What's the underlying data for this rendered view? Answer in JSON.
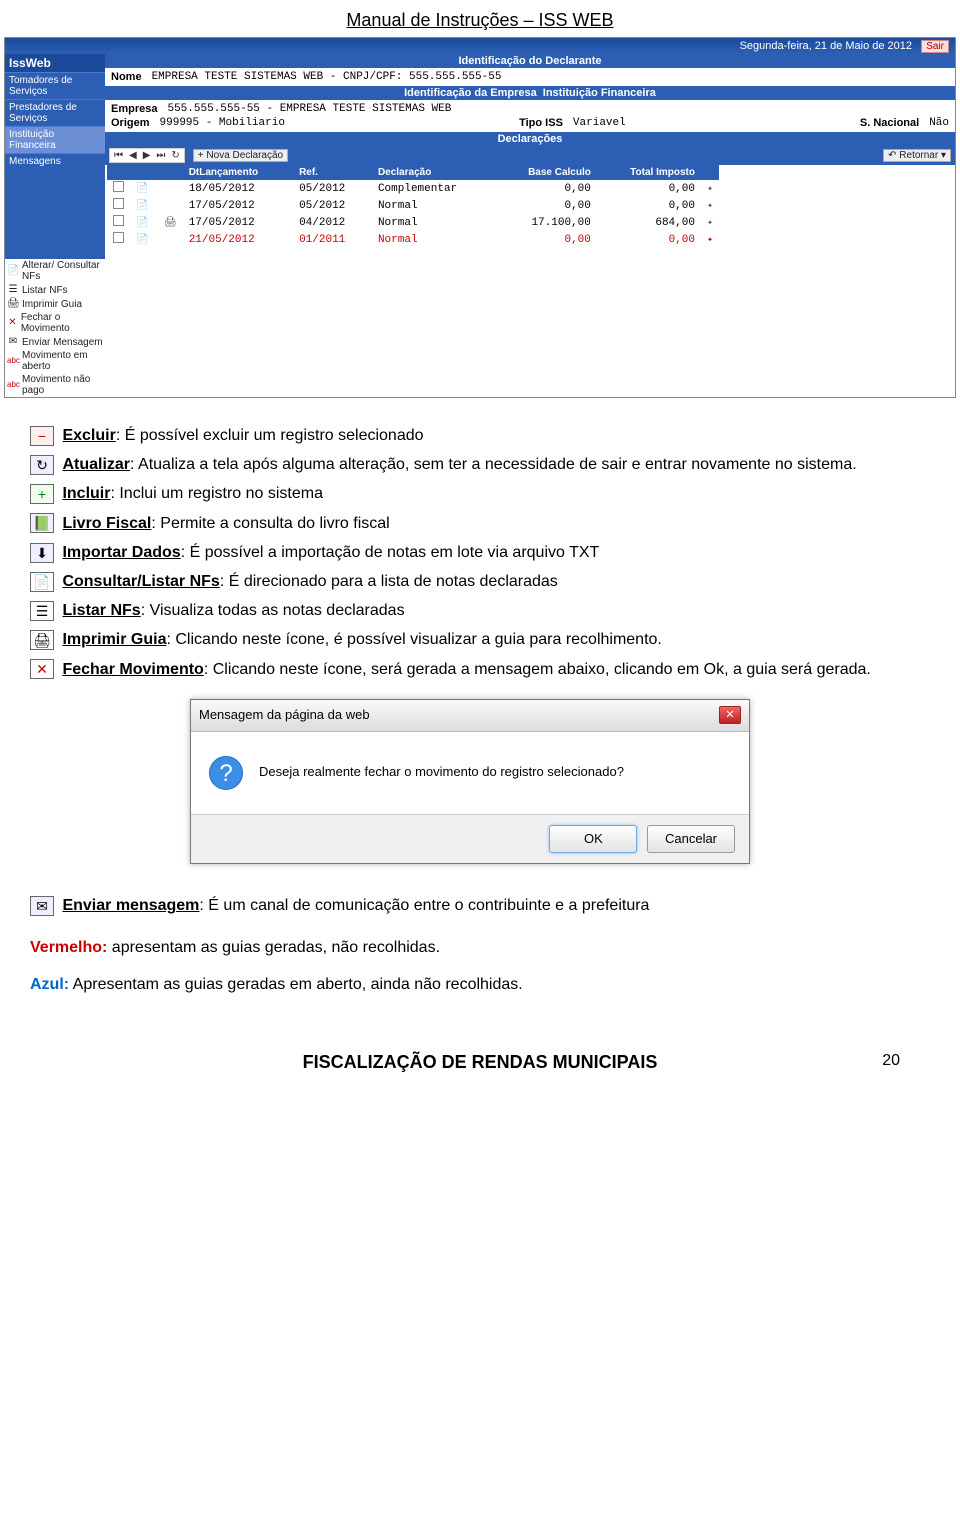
{
  "doc": {
    "header_title": "Manual de Instruções – ISS WEB",
    "footer_text": "FISCALIZAÇÃO DE RENDAS MUNICIPAIS",
    "page_number": "20"
  },
  "topbar": {
    "date": "Segunda-feira, 21 de Maio de 2012",
    "exit": "Sair"
  },
  "sidebar": {
    "brand": "IssWeb",
    "items": [
      "Tomadores de Serviços",
      "Prestadores de Serviços",
      "Instituição Financeira",
      "Mensagens"
    ]
  },
  "sidebar_bottom": {
    "items": [
      "Alterar/ Consultar NFs",
      "Listar NFs",
      "Imprimir Guia",
      "Fechar o Movimento",
      "Enviar Mensagem",
      "Movimento em aberto",
      "Movimento não pago"
    ]
  },
  "ident_declarante": {
    "title": "Identificação do Declarante",
    "nome_lbl": "Nome",
    "nome_val": "EMPRESA TESTE SISTEMAS WEB - CNPJ/CPF: 555.555.555-55"
  },
  "ident_empresa": {
    "title": "Identificação da Empresa",
    "pill": "Instituição Financeira",
    "empresa_lbl": "Empresa",
    "empresa_val": "555.555.555-55 - EMPRESA TESTE SISTEMAS WEB",
    "origem_lbl": "Origem",
    "origem_val": "999995 - Mobiliario",
    "tipoiss_lbl": "Tipo ISS",
    "tipoiss_val": "Variavel",
    "snac_lbl": "S. Nacional",
    "snac_val": "Não"
  },
  "declaracoes": {
    "title": "Declarações",
    "btn_new": "+ Nova Declaração",
    "btn_ret": "Retornar",
    "cols": [
      "DtLançamento",
      "Ref.",
      "Declaração",
      "Base Calculo",
      "Total Imposto"
    ],
    "rows": [
      {
        "dt": "18/05/2012",
        "ref": "05/2012",
        "decl": "Complementar",
        "base": "0,00",
        "tot": "0,00",
        "red": false
      },
      {
        "dt": "17/05/2012",
        "ref": "05/2012",
        "decl": "Normal",
        "base": "0,00",
        "tot": "0,00",
        "red": false
      },
      {
        "dt": "17/05/2012",
        "ref": "04/2012",
        "decl": "Normal",
        "base": "17.100,00",
        "tot": "684,00",
        "red": false
      },
      {
        "dt": "21/05/2012",
        "ref": "01/2011",
        "decl": "Normal",
        "base": "0,00",
        "tot": "0,00",
        "red": true
      }
    ]
  },
  "body": {
    "excluir_lbl": "Excluir",
    "excluir_txt": ": É possível excluir um registro selecionado",
    "atualizar_lbl": "Atualizar",
    "atualizar_txt": ": Atualiza a tela após alguma alteração, sem ter a necessidade de sair e entrar novamente no sistema.",
    "incluir_lbl": "Incluir",
    "incluir_txt": ": Inclui um registro no sistema",
    "livro_lbl": "Livro Fiscal",
    "livro_txt": ": Permite a consulta do livro fiscal",
    "importar_lbl": "Importar Dados",
    "importar_txt": ": É possível a importação de notas em lote via arquivo TXT",
    "consultar_lbl": "Consultar/Listar NFs",
    "consultar_txt": ": É direcionado para a lista de notas declaradas",
    "listar_lbl": "Listar NFs",
    "listar_txt": ": Visualiza todas as notas declaradas",
    "imprimir_lbl": "Imprimir Guia",
    "imprimir_txt": ": Clicando neste ícone, é possível visualizar a guia para recolhimento.",
    "fechar_lbl": "Fechar Movimento",
    "fechar_txt": ": Clicando neste ícone, será gerada a mensagem abaixo, clicando em Ok, a guia será gerada.",
    "enviar_lbl": "Enviar mensagem",
    "enviar_txt": ": É um canal de comunicação entre o contribuinte e a prefeitura",
    "vermelho_lbl": "Vermelho:",
    "vermelho_txt": " apresentam as guias geradas, não recolhidas.",
    "azul_lbl": "Azul:",
    "azul_txt": " Apresentam as guias geradas em aberto, ainda não recolhidas."
  },
  "dialog": {
    "title": "Mensagem da página da web",
    "message": "Deseja realmente fechar o movimento do registro selecionado?",
    "ok": "OK",
    "cancel": "Cancelar"
  }
}
